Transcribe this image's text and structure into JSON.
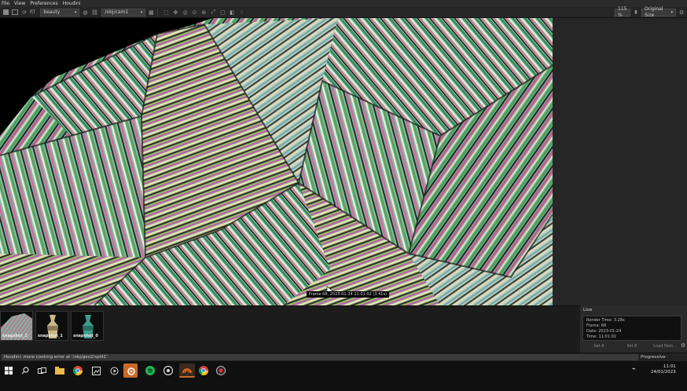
{
  "menu": {
    "items": [
      "File",
      "View",
      "Preferences",
      "Houdini"
    ]
  },
  "toolbar": {
    "render_label": "RT",
    "aov": "beauty",
    "camera_path": "/obj/cam1",
    "zoom": "115 %",
    "size_mode": "Original Size"
  },
  "viewport": {
    "frame_caption": "Frame 68, 2023-01-24 11:01:02 (3.41s)"
  },
  "snapshots": [
    {
      "label": "snapshot_2"
    },
    {
      "label": "snapshot_1"
    },
    {
      "label": "snapshot_0"
    }
  ],
  "live": {
    "title": "Live",
    "render_time": "Render Time: 3.28s",
    "frame": "Frame: 68",
    "date": "Date: 2023-01-24",
    "time": "Time: 11:01:02",
    "buttons": [
      "Set A",
      "Set B",
      "Load Pass..."
    ]
  },
  "status": {
    "message": "Houdini: more cooking error at '/obj/geo2/split1'",
    "right": "Progressive Rendering..."
  },
  "taskbar": {
    "clock_time": "11:01",
    "clock_date": "24/01/2023"
  },
  "colors": {
    "accent_orange": "#c96a2a",
    "spotify_green": "#1db954",
    "background": "#1f1f1f"
  }
}
